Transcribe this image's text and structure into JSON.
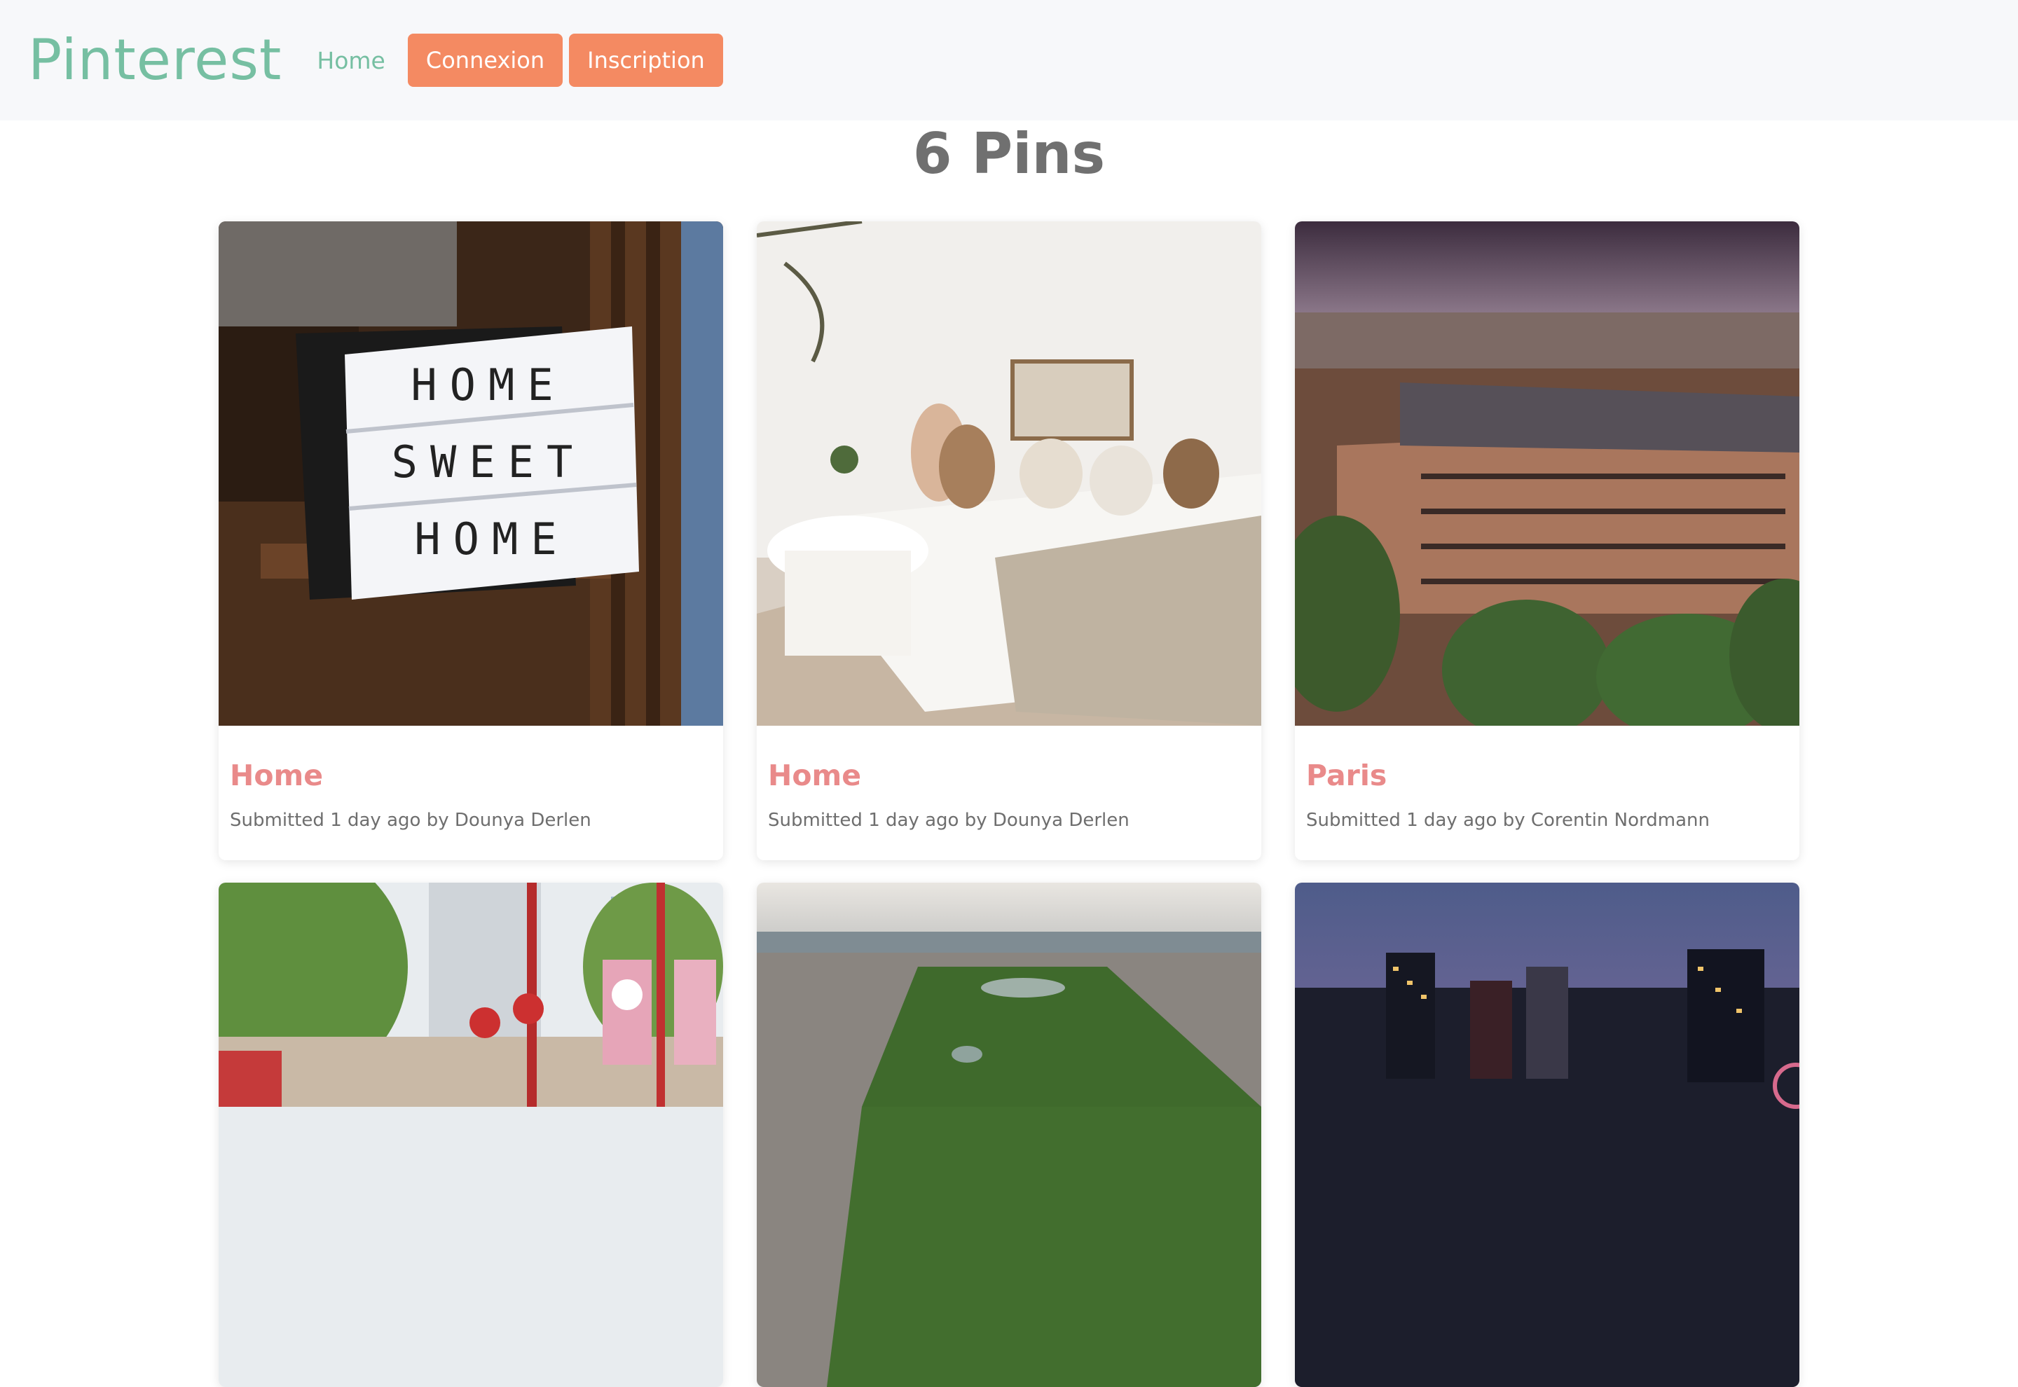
{
  "nav": {
    "brand": "Pinterest",
    "home": "Home",
    "login": "Connexion",
    "signup": "Inscription"
  },
  "main": {
    "title": "6 Pins"
  },
  "pins": [
    {
      "title": "Home",
      "meta": "Submitted 1 day ago by Dounya Derlen",
      "image": "home-sweet-home-lightbox"
    },
    {
      "title": "Home",
      "meta": "Submitted 1 day ago by Dounya Derlen",
      "image": "white-living-room-sofa"
    },
    {
      "title": "Paris",
      "meta": "Submitted 1 day ago by Corentin Nordmann",
      "image": "paris-haussmann-buildings"
    },
    {
      "title": "",
      "meta": "",
      "image": "chinatown-street-lanterns"
    },
    {
      "title": "",
      "meta": "",
      "image": "central-park-aerial"
    },
    {
      "title": "",
      "meta": "",
      "image": "city-skyline-dusk"
    }
  ],
  "colors": {
    "brand": "#76bfa2",
    "button": "#f48a62",
    "pin_title": "#e98a8a",
    "navbar_bg": "#f7f8fa"
  }
}
